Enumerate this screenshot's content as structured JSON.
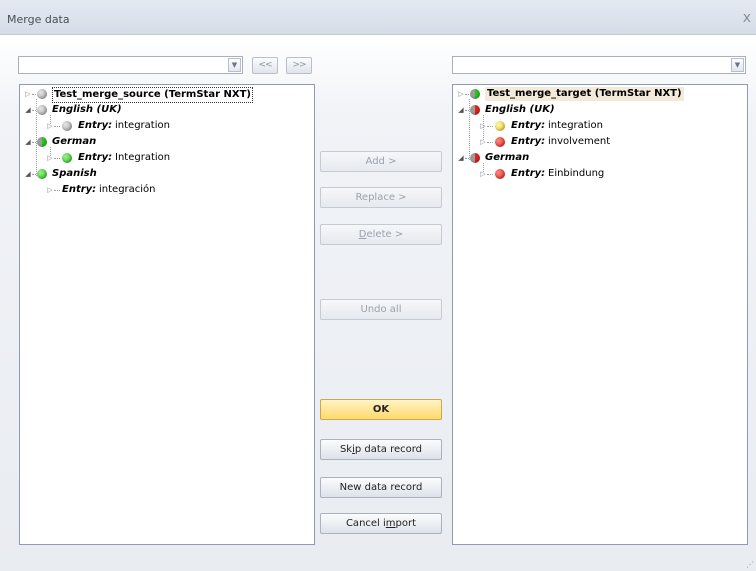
{
  "window": {
    "title": "Merge data",
    "close": "x"
  },
  "nav": {
    "back": "<<",
    "forward": ">>"
  },
  "source_tree": {
    "root": "Test_merge_source (TermStar NXT)",
    "english": "English (UK)",
    "english_entry_key": "Entry:",
    "english_entry_val": "integration",
    "german": "German",
    "german_entry_key": "Entry:",
    "german_entry_val": "Integration",
    "spanish": "Spanish",
    "spanish_entry_key": "Entry:",
    "spanish_entry_val": "integración"
  },
  "target_tree": {
    "root": "Test_merge_target (TermStar NXT)",
    "english": "English (UK)",
    "english_entry1_key": "Entry:",
    "english_entry1_val": "integration",
    "english_entry2_key": "Entry:",
    "english_entry2_val": "involvement",
    "german": "German",
    "german_entry_key": "Entry:",
    "german_entry_val": "Einbindung"
  },
  "buttons": {
    "add": "Add >",
    "replace": "Replace >",
    "delete_u": "D",
    "delete_rest": "elete >",
    "undo_all": "Undo all",
    "ok": "OK",
    "skip_a": "Sk",
    "skip_u": "i",
    "skip_b": "p data record",
    "new_record": "New data record",
    "cancel_a": "Cancel i",
    "cancel_u": "m",
    "cancel_b": "port"
  },
  "colors": {
    "status_gray": "#9c9c9c",
    "status_green": "#1fbf12",
    "status_red": "#dc1a12",
    "status_yellow": "#e3c51a",
    "ok_button": "#ffd96b"
  }
}
